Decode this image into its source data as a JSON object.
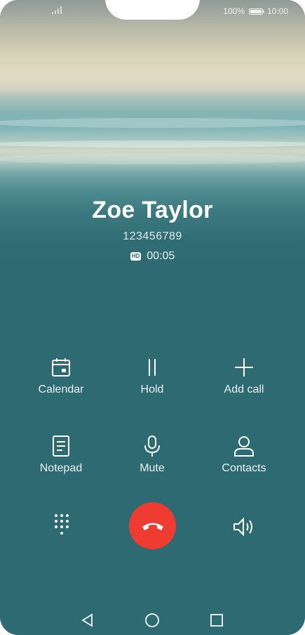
{
  "status_bar": {
    "battery_percent": "100%",
    "time": "10:00"
  },
  "caller": {
    "name": "Zoe Taylor",
    "number": "123456789",
    "hd_badge": "HD",
    "duration": "00:05"
  },
  "actions": [
    {
      "label": "Calendar",
      "icon": "calendar-icon"
    },
    {
      "label": "Hold",
      "icon": "pause-icon"
    },
    {
      "label": "Add call",
      "icon": "plus-icon"
    },
    {
      "label": "Notepad",
      "icon": "notepad-icon"
    },
    {
      "label": "Mute",
      "icon": "microphone-icon"
    },
    {
      "label": "Contacts",
      "icon": "person-icon"
    }
  ],
  "bottom_controls": {
    "keypad_icon": "dialpad-icon",
    "end_call_icon": "end-call-icon",
    "speaker_icon": "speaker-icon"
  },
  "colors": {
    "background": "#2e6a72",
    "end_call": "#ef3b32"
  }
}
